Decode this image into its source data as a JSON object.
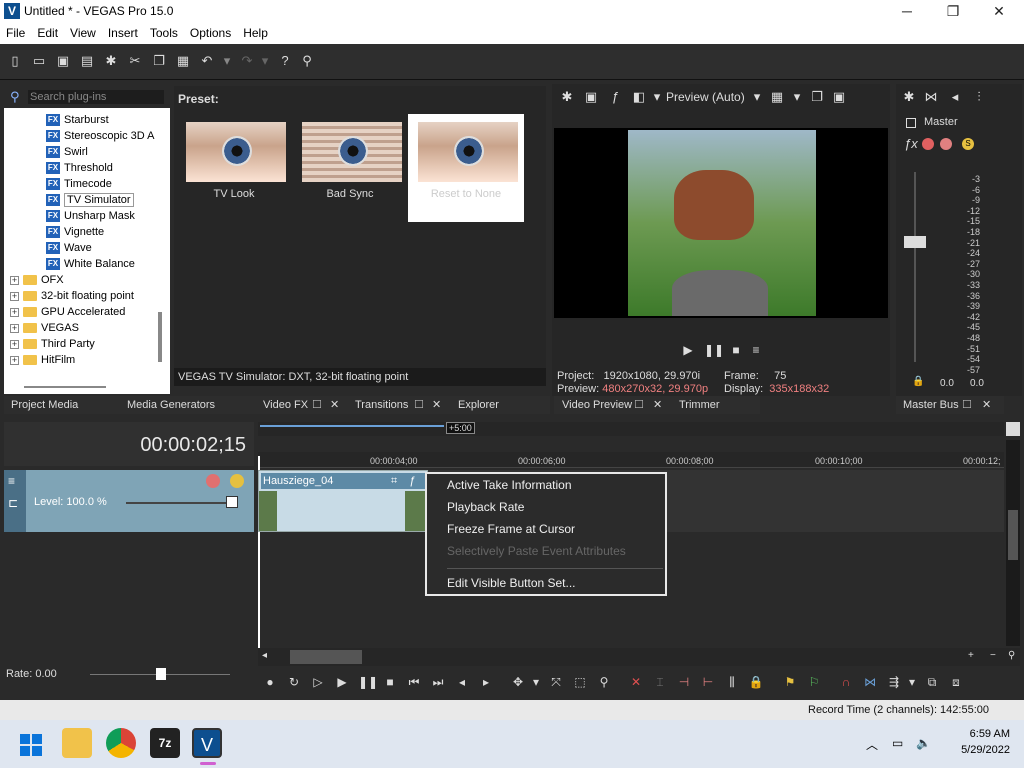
{
  "window": {
    "title": "Untitled * - VEGAS Pro 15.0",
    "app_icon": "V"
  },
  "window_buttons": [
    "─",
    "❐",
    "✕"
  ],
  "menu": [
    "File",
    "Edit",
    "View",
    "Insert",
    "Tools",
    "Options",
    "Help"
  ],
  "plugins": {
    "search_placeholder": "Search plug-ins",
    "fx_items": [
      "Starburst",
      "Stereoscopic 3D A",
      "Swirl",
      "Threshold",
      "Timecode",
      "TV Simulator",
      "Unsharp Mask",
      "Vignette",
      "Wave",
      "White Balance"
    ],
    "fx_badge": "FX",
    "selected": "TV Simulator",
    "folders": [
      "OFX",
      "32-bit floating point",
      "GPU Accelerated",
      "VEGAS",
      "Third Party",
      "HitFilm"
    ]
  },
  "presets": {
    "heading": "Preset:",
    "items": [
      "TV Look",
      "Bad Sync",
      "Reset to None"
    ],
    "status": "VEGAS TV Simulator: DXT, 32-bit floating point"
  },
  "left_tabs": [
    "Project Media",
    "Media Generators",
    "Video FX",
    "Transitions",
    "Explorer"
  ],
  "preview": {
    "mode": "Preview (Auto)",
    "project_label": "Project:",
    "project_value": "1920x1080, 29.970i",
    "frame_label": "Frame:",
    "frame_value": "75",
    "preview_label": "Preview:",
    "preview_value": "480x270x32, 29.970p",
    "display_label": "Display:",
    "display_value": "335x188x32",
    "tabs": [
      "Video Preview",
      "Trimmer"
    ]
  },
  "master": {
    "label": "Master",
    "scale": [
      "3",
      "6",
      "9",
      "12",
      "15",
      "18",
      "21",
      "24",
      "27",
      "30",
      "33",
      "36",
      "39",
      "42",
      "45",
      "48",
      "51",
      "54",
      "57"
    ],
    "left_value": "0.0",
    "right_value": "0.0",
    "tab": "Master Bus"
  },
  "timeline": {
    "timecode": "00:00:02;15",
    "marker": "+5:00",
    "ruler": [
      "00:00:04;00",
      "00:00:06;00",
      "00:00:08;00",
      "00:00:10;00",
      "00:00:12;"
    ],
    "track_level": "Level: 100.0 %",
    "clip_name": "Hausziege_04",
    "rate": "Rate: 0.00"
  },
  "context_menu": {
    "items": [
      "Active Take Information",
      "Playback Rate",
      "Freeze Frame at Cursor",
      "Selectively Paste Event Attributes",
      "Edit Visible Button Set..."
    ]
  },
  "status": {
    "record_time": "Record Time (2 channels): 142:55:00"
  },
  "taskbar": {
    "time": "6:59 AM",
    "date": "5/29/2022"
  },
  "colors": {
    "accent": "#2262b8",
    "timeline_bg": "#2a2a2a",
    "track": "#7fa4b6"
  }
}
